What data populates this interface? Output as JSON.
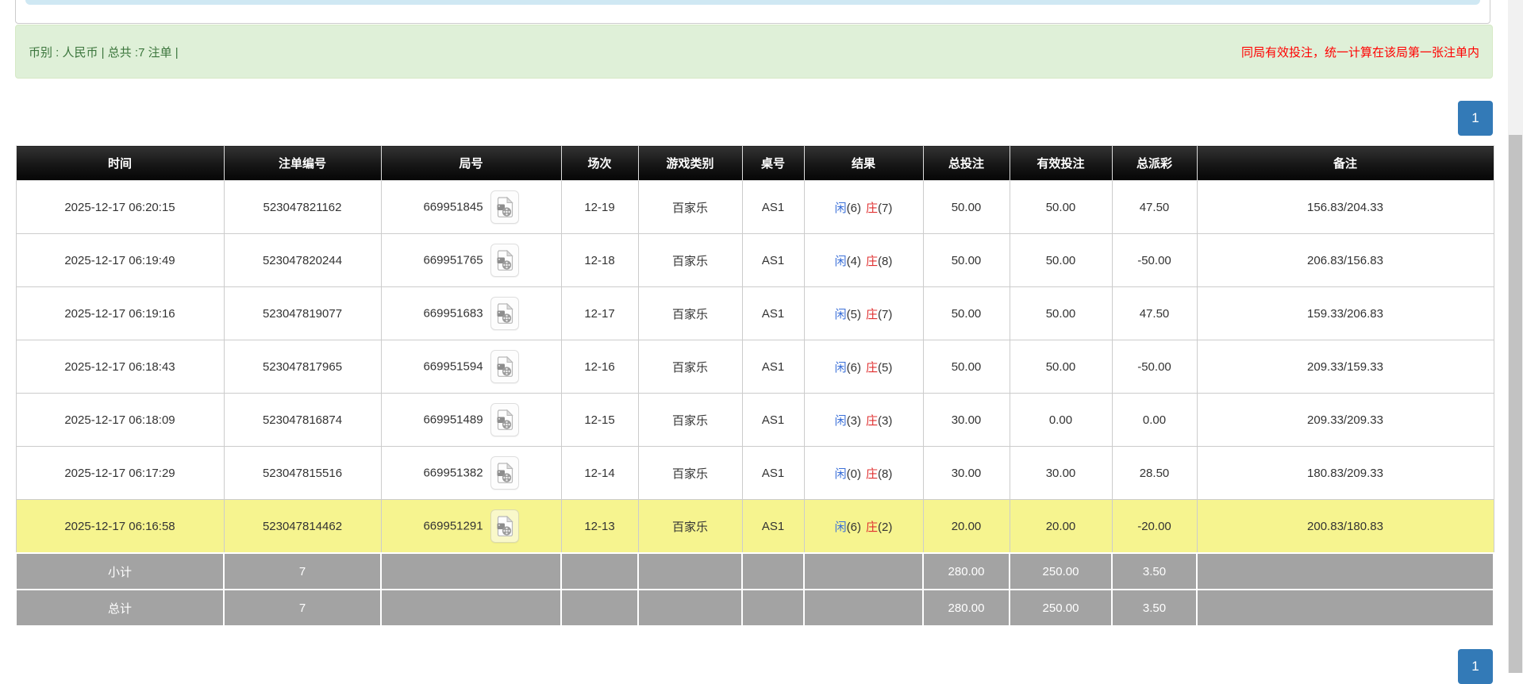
{
  "banner": {
    "left_text": "币别 : 人民币 | 总共 :7 注单 |",
    "right_text": "同局有效投注，统一计算在该局第一张注单内"
  },
  "pagination": {
    "page": "1"
  },
  "colors": {
    "banner_bg": "#dff0d8",
    "banner_text": "#3c763d",
    "notice_red": "#ff0000",
    "pager_blue": "#337ab7",
    "highlight_yellow": "#f6f48f",
    "summary_gray": "#a3a3a3",
    "amount_blue": "#3a6fd8",
    "negative_red": "#ff0000"
  },
  "table": {
    "headers": [
      "时间",
      "注单编号",
      "局号",
      "场次",
      "游戏类别",
      "桌号",
      "结果",
      "总投注",
      "有效投注",
      "总派彩",
      "备注"
    ],
    "rows": [
      {
        "time": "2025-12-17 06:20:15",
        "bet_id": "523047821162",
        "game_id": "669951845",
        "session": "12-19",
        "game_type": "百家乐",
        "table_no": "AS1",
        "player_label": "闲",
        "player_score": "(6)",
        "banker_label": "庄",
        "banker_score": "(7)",
        "total_bet": "50.00",
        "valid_bet": "50.00",
        "payout": "47.50",
        "remark": "156.83/204.33",
        "highlight": false
      },
      {
        "time": "2025-12-17 06:19:49",
        "bet_id": "523047820244",
        "game_id": "669951765",
        "session": "12-18",
        "game_type": "百家乐",
        "table_no": "AS1",
        "player_label": "闲",
        "player_score": "(4)",
        "banker_label": "庄",
        "banker_score": "(8)",
        "total_bet": "50.00",
        "valid_bet": "50.00",
        "payout": "-50.00",
        "remark": "206.83/156.83",
        "highlight": false
      },
      {
        "time": "2025-12-17 06:19:16",
        "bet_id": "523047819077",
        "game_id": "669951683",
        "session": "12-17",
        "game_type": "百家乐",
        "table_no": "AS1",
        "player_label": "闲",
        "player_score": "(5)",
        "banker_label": "庄",
        "banker_score": "(7)",
        "total_bet": "50.00",
        "valid_bet": "50.00",
        "payout": "47.50",
        "remark": "159.33/206.83",
        "highlight": false
      },
      {
        "time": "2025-12-17 06:18:43",
        "bet_id": "523047817965",
        "game_id": "669951594",
        "session": "12-16",
        "game_type": "百家乐",
        "table_no": "AS1",
        "player_label": "闲",
        "player_score": "(6)",
        "banker_label": "庄",
        "banker_score": "(5)",
        "total_bet": "50.00",
        "valid_bet": "50.00",
        "payout": "-50.00",
        "remark": "209.33/159.33",
        "highlight": false
      },
      {
        "time": "2025-12-17 06:18:09",
        "bet_id": "523047816874",
        "game_id": "669951489",
        "session": "12-15",
        "game_type": "百家乐",
        "table_no": "AS1",
        "player_label": "闲",
        "player_score": "(3)",
        "banker_label": "庄",
        "banker_score": "(3)",
        "total_bet": "30.00",
        "valid_bet": "0.00",
        "payout": "0.00",
        "remark": "209.33/209.33",
        "highlight": false
      },
      {
        "time": "2025-12-17 06:17:29",
        "bet_id": "523047815516",
        "game_id": "669951382",
        "session": "12-14",
        "game_type": "百家乐",
        "table_no": "AS1",
        "player_label": "闲",
        "player_score": "(0)",
        "banker_label": "庄",
        "banker_score": "(8)",
        "total_bet": "30.00",
        "valid_bet": "30.00",
        "payout": "28.50",
        "remark": "180.83/209.33",
        "highlight": false
      },
      {
        "time": "2025-12-17 06:16:58",
        "bet_id": "523047814462",
        "game_id": "669951291",
        "session": "12-13",
        "game_type": "百家乐",
        "table_no": "AS1",
        "player_label": "闲",
        "player_score": "(6)",
        "banker_label": "庄",
        "banker_score": "(2)",
        "total_bet": "20.00",
        "valid_bet": "20.00",
        "payout": "-20.00",
        "remark": "200.83/180.83",
        "highlight": true
      }
    ],
    "subtotal": {
      "label": "小计",
      "count": "7",
      "total_bet": "280.00",
      "valid_bet": "250.00",
      "payout": "3.50"
    },
    "total": {
      "label": "总计",
      "count": "7",
      "total_bet": "280.00",
      "valid_bet": "250.00",
      "payout": "3.50"
    }
  },
  "icons": {
    "video_button": "film-file-icon"
  }
}
